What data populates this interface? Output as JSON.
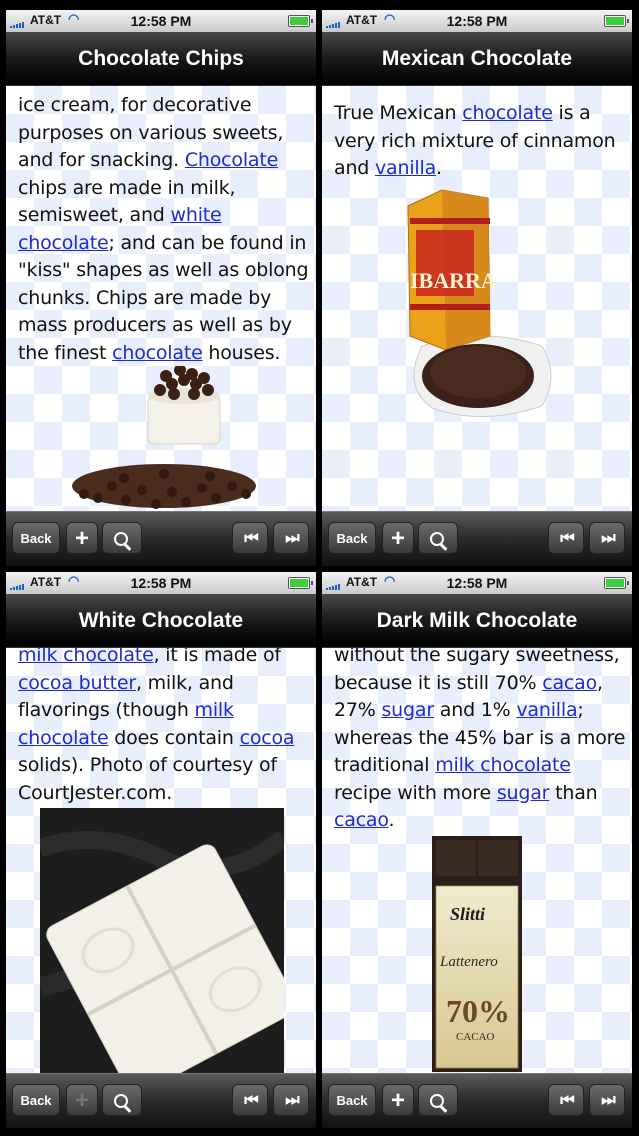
{
  "status": {
    "carrier": "AT&T",
    "time": "12:58 PM"
  },
  "toolbar": {
    "back": "Back",
    "plus": "+",
    "prev": "⏮",
    "next": "⏭"
  },
  "panels": [
    {
      "title": "Chocolate Chips",
      "text": {
        "t0": "ice cream, for decorative purposes on various sweets, and for snacking. ",
        "l1": "Chocolate",
        "t1": " chips are made in milk, semisweet, and ",
        "l2": "white chocolate",
        "t2": "; and can be found in \"kiss\" shapes as well as oblong chunks. Chips are made by mass producers as well as by the finest ",
        "l3": "chocolate",
        "t3": " houses."
      }
    },
    {
      "title": "Mexican Chocolate",
      "text": {
        "t0": "True Mexican ",
        "l1": "chocolate",
        "t1": " is a very rich mixture of cinnamon and ",
        "l2": "vanilla",
        "t2": "."
      },
      "box_label": "IBARRA"
    },
    {
      "title": "White Chocolate",
      "text": {
        "l0": "milk chocolate",
        "t0": ", it is made of ",
        "l1": "cocoa butter",
        "t1": ", milk, and flavorings (though ",
        "l2": "milk chocolate",
        "t2": " does contain ",
        "l3": "cocoa",
        "t3": " solids). Photo of courtesy of CourtJester.com."
      }
    },
    {
      "title": "Dark Milk Chocolate",
      "text": {
        "t0": "without the sugary sweetness, because it is still 70% ",
        "l1": "cacao",
        "t1": ", 27% ",
        "l2": "sugar",
        "t2": " and 1% ",
        "l3": "vanilla",
        "t3": "; whereas the 45% bar is a more traditional ",
        "l4": "milk chocolate",
        "t4": " recipe with more ",
        "l5": "sugar",
        "t5": " than ",
        "l6": "cacao",
        "t6": "."
      },
      "bar_brand": "Slitti",
      "bar_name": "Lattenero",
      "bar_percent": "70%",
      "bar_sub": "CACAO"
    }
  ],
  "colors": {
    "link": "#1b2bd6",
    "pattern": "#e8eefb",
    "navbar": "#1a1a1a"
  }
}
